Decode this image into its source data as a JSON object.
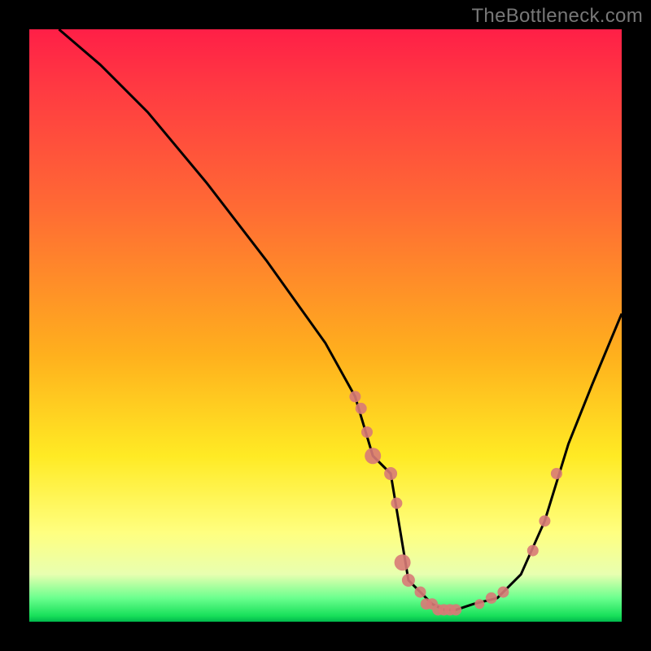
{
  "watermark": "TheBottleneck.com",
  "chart_data": {
    "type": "line",
    "title": "",
    "xlabel": "",
    "ylabel": "",
    "xlim": [
      0,
      100
    ],
    "ylim": [
      0,
      100
    ],
    "background_gradient": [
      "#ff1f47",
      "#ffea24",
      "#18e05a"
    ],
    "series": [
      {
        "name": "curve",
        "x": [
          5,
          12,
          20,
          30,
          40,
          50,
          55,
          58,
          61,
          64,
          66,
          68,
          70,
          72,
          75,
          79,
          83,
          87,
          91,
          95,
          100
        ],
        "y": [
          100,
          94,
          86,
          74,
          61,
          47,
          38,
          28,
          25,
          7,
          5,
          3,
          2,
          2,
          3,
          4,
          8,
          17,
          30,
          40,
          52
        ]
      }
    ],
    "markers": {
      "name": "highlighted-points",
      "color": "#d87a77",
      "points": [
        {
          "x": 55,
          "y": 38,
          "r": 7
        },
        {
          "x": 56,
          "y": 36,
          "r": 7
        },
        {
          "x": 57,
          "y": 32,
          "r": 7
        },
        {
          "x": 58,
          "y": 28,
          "r": 10
        },
        {
          "x": 61,
          "y": 25,
          "r": 8
        },
        {
          "x": 62,
          "y": 20,
          "r": 7
        },
        {
          "x": 63,
          "y": 10,
          "r": 10
        },
        {
          "x": 64,
          "y": 7,
          "r": 8
        },
        {
          "x": 66,
          "y": 5,
          "r": 7
        },
        {
          "x": 67,
          "y": 3,
          "r": 7
        },
        {
          "x": 68,
          "y": 3,
          "r": 7
        },
        {
          "x": 69,
          "y": 2,
          "r": 7
        },
        {
          "x": 70,
          "y": 2,
          "r": 7
        },
        {
          "x": 71,
          "y": 2,
          "r": 7
        },
        {
          "x": 72,
          "y": 2,
          "r": 7
        },
        {
          "x": 76,
          "y": 3,
          "r": 6
        },
        {
          "x": 78,
          "y": 4,
          "r": 7
        },
        {
          "x": 80,
          "y": 5,
          "r": 7
        },
        {
          "x": 85,
          "y": 12,
          "r": 7
        },
        {
          "x": 87,
          "y": 17,
          "r": 7
        },
        {
          "x": 89,
          "y": 25,
          "r": 7
        }
      ]
    }
  }
}
